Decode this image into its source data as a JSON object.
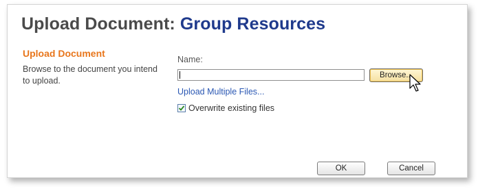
{
  "header": {
    "title_prefix": "Upload Document: ",
    "title_list": "Group Resources"
  },
  "section": {
    "heading": "Upload Document",
    "description": "Browse to the document you intend to upload."
  },
  "form": {
    "name_label": "Name:",
    "file_value": "",
    "browse_label": "Browse...",
    "upload_multiple_link": "Upload Multiple Files...",
    "overwrite_label": "Overwrite existing files",
    "overwrite_checked": true
  },
  "actions": {
    "ok_label": "OK",
    "cancel_label": "Cancel"
  },
  "colors": {
    "title_prefix": "#4a4a4a",
    "title_list": "#1f3a8c",
    "section_heading": "#e8761c",
    "link": "#2a57b3"
  }
}
